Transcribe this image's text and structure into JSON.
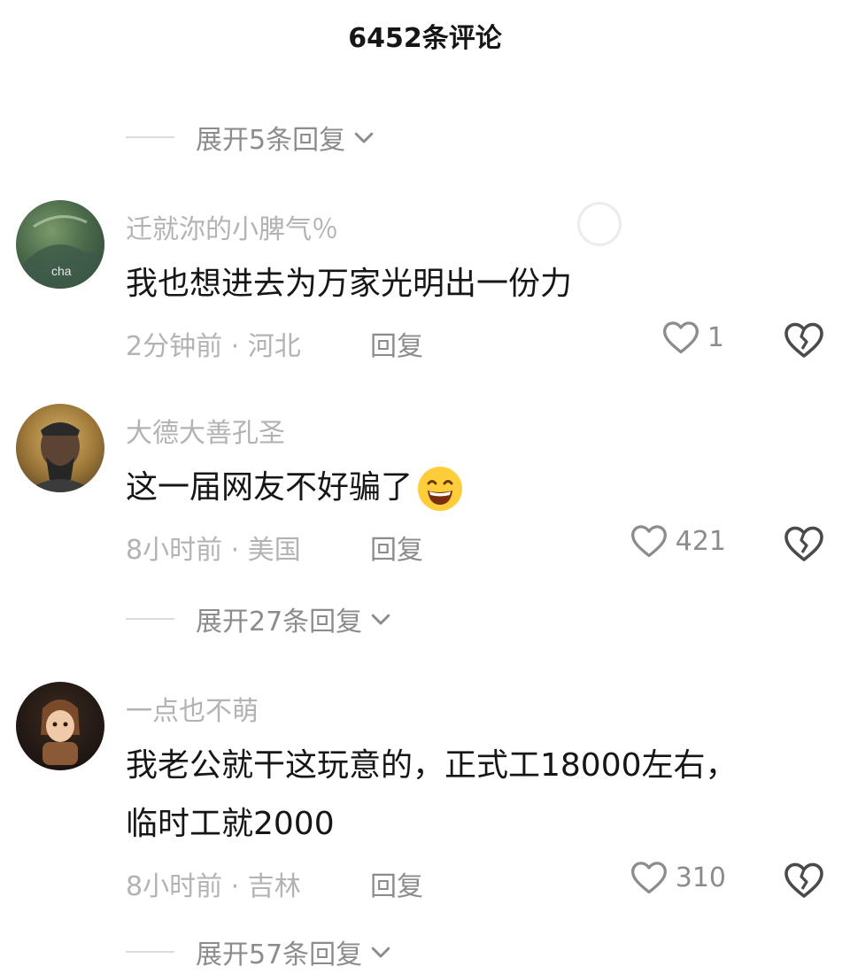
{
  "header": {
    "title": "6452条评论"
  },
  "expand_1": {
    "label": "展开5条回复"
  },
  "comments": [
    {
      "username": "迁就沵的小脾气％",
      "text": "我也想进去为万家光明出一份力",
      "time": "2分钟前",
      "location": "河北",
      "reply_label": "回复",
      "likes": "1"
    },
    {
      "username": "大德大善孔圣",
      "text": "这一届网友不好骗了",
      "emoji": "grinning-face-emoji",
      "time": "8小时前",
      "location": "美国",
      "reply_label": "回复",
      "likes": "421"
    },
    {
      "username": "一点也不萌",
      "text_line1": "我老公就干这玩意的，正式工18000左右，",
      "text_line2": "临时工就2000",
      "time": "8小时前",
      "location": "吉林",
      "reply_label": "回复",
      "likes": "310"
    }
  ],
  "expand_2": {
    "label": "展开27条回复"
  },
  "expand_3": {
    "label": "展开57条回复"
  },
  "meta_separator": "·",
  "colors": {
    "text": "#161616",
    "muted": "#b3b3b3",
    "secondary": "#8c8c8c"
  }
}
